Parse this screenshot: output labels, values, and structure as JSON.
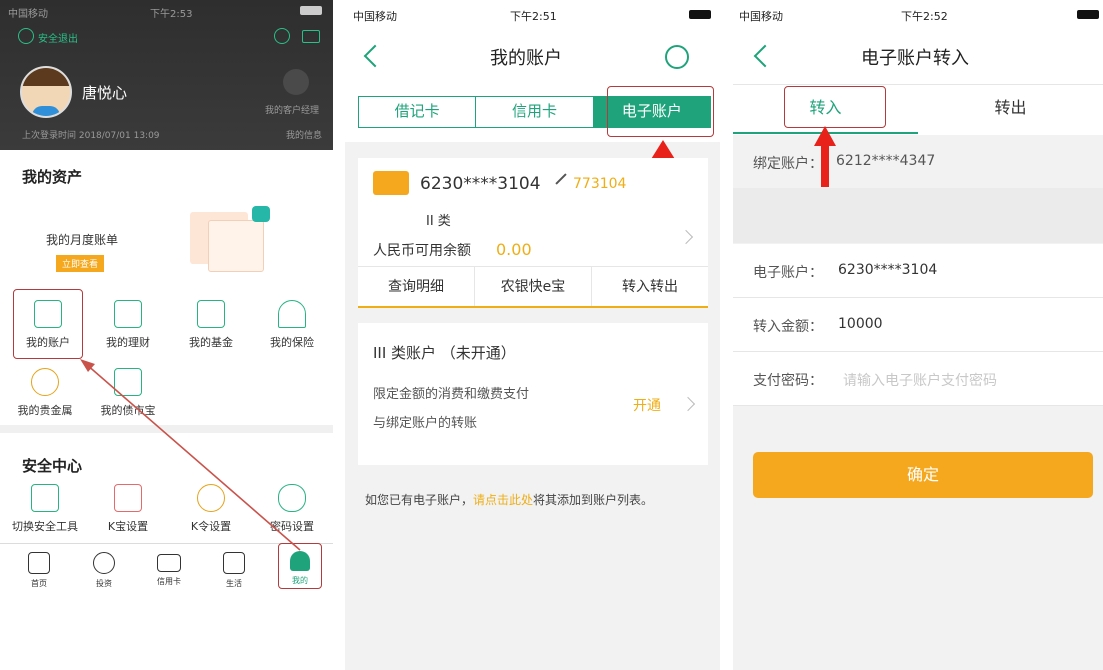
{
  "panel1": {
    "status": {
      "carrier": "中国移动",
      "time": "下午2:53"
    },
    "header": {
      "logout": "安全退出",
      "username": "唐悦心",
      "manager": "我的客户经理",
      "last_login": "上次登录时间 2018/07/01 13:09",
      "my_info": "我的信息"
    },
    "assets": {
      "title": "我的资产",
      "monthly_bill": "我的月度账单",
      "view_now": "立即查看",
      "grid": [
        {
          "label": "我的账户",
          "icon": "account-search-icon"
        },
        {
          "label": "我的理财",
          "icon": "coins-stack-icon"
        },
        {
          "label": "我的基金",
          "icon": "trend-chart-icon"
        },
        {
          "label": "我的保险",
          "icon": "umbrella-icon"
        },
        {
          "label": "我的贵金属",
          "icon": "gold-basket-icon"
        },
        {
          "label": "我的债市宝",
          "icon": "bond-doc-icon"
        }
      ]
    },
    "security": {
      "title": "安全中心",
      "grid": [
        {
          "label": "切换安全工具",
          "icon": "shield-plus-icon"
        },
        {
          "label": "K宝设置",
          "icon": "kbao-icon"
        },
        {
          "label": "K令设置",
          "icon": "kling-icon"
        },
        {
          "label": "密码设置",
          "icon": "password-icon"
        }
      ]
    },
    "tabbar": [
      "首页",
      "投资",
      "信用卡",
      "生活",
      "我的"
    ]
  },
  "panel2": {
    "status": {
      "carrier": "中国移动",
      "time": "下午2:51"
    },
    "title": "我的账户",
    "tabs": [
      "借记卡",
      "信用卡",
      "电子账户"
    ],
    "account": {
      "number": "6230****3104",
      "alias": "773104",
      "class": "II 类",
      "balance_label": "人民币可用余额",
      "balance": "0.00",
      "actions": [
        "查询明细",
        "农银快e宝",
        "转入转出"
      ]
    },
    "class3": {
      "title": "III 类账户 （未开通）",
      "desc1": "限定金额的消费和缴费支付",
      "desc2": "与绑定账户的转账",
      "open": "开通"
    },
    "hint": {
      "prefix": "如您已有电子账户，",
      "link": "请点击此处",
      "suffix": "将其添加到账户列表。"
    }
  },
  "panel3": {
    "status": {
      "carrier": "中国移动",
      "time": "下午2:52"
    },
    "title": "电子账户转入",
    "tabs": [
      "转入",
      "转出"
    ],
    "bound_label": "绑定账户：",
    "bound_value": "6212****4347",
    "fields": [
      {
        "label": "电子账户：",
        "value": "6230****3104"
      },
      {
        "label": "转入金额：",
        "value": "10000"
      },
      {
        "label": "支付密码：",
        "placeholder": "请输入电子账户支付密码"
      }
    ],
    "confirm": "确定"
  },
  "colors": {
    "green": "#1fa37a",
    "yellow": "#efae16",
    "orange_button": "#f5a81e",
    "annotation_red": "#e8211b"
  }
}
